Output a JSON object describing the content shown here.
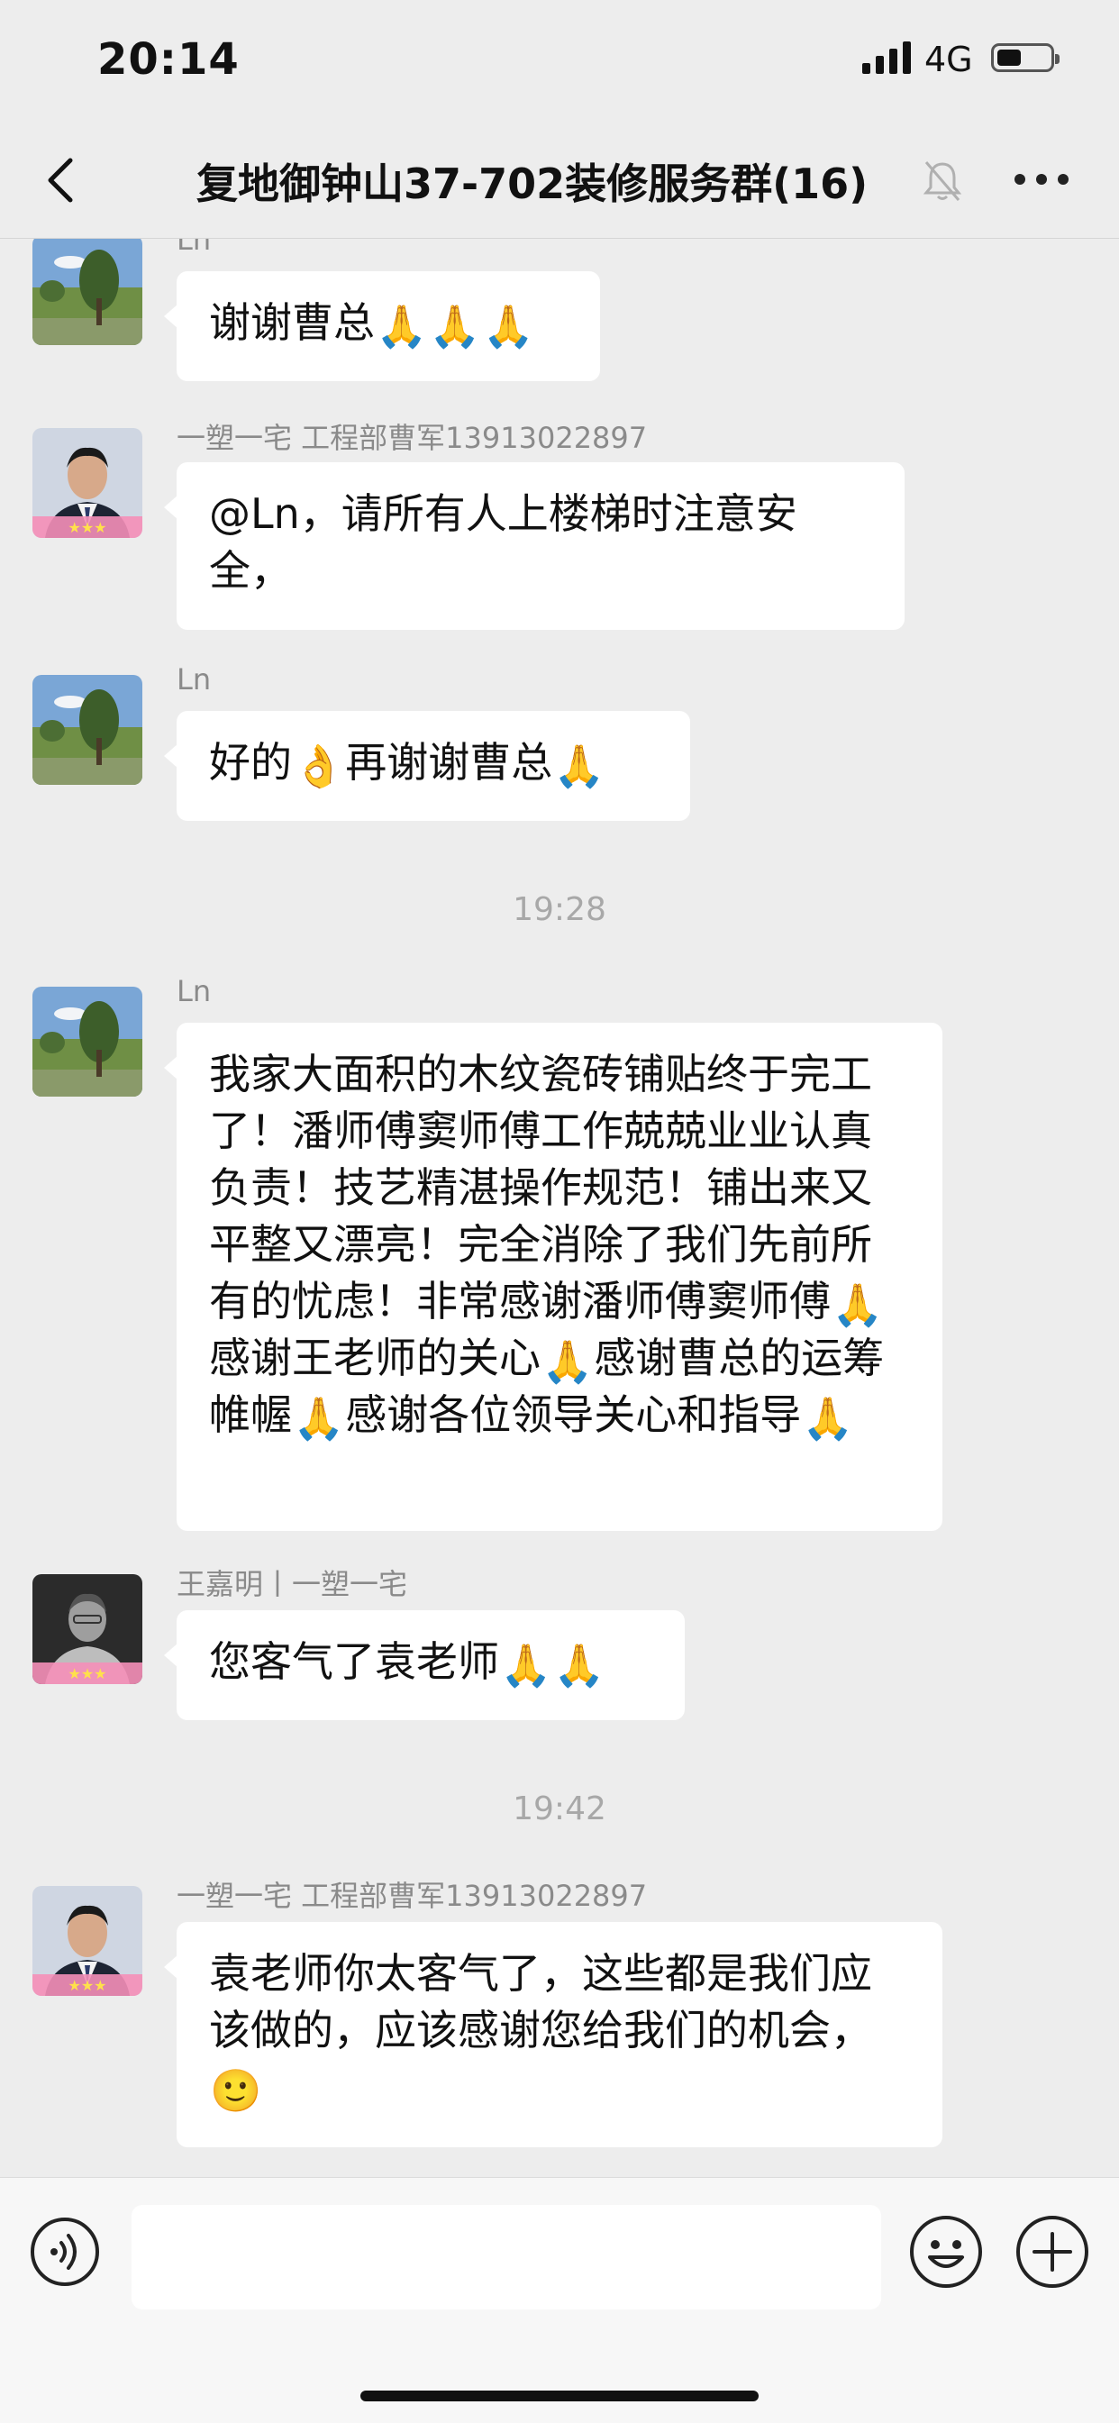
{
  "status": {
    "time": "20:14",
    "network": "4G"
  },
  "header": {
    "title": "复地御钟山37-702装修服务群(16)"
  },
  "icons": {
    "back": "chevron-left-icon",
    "mute": "bell-off-icon",
    "more": "more-dots-icon",
    "voice": "voice-input-icon",
    "emoji": "emoji-icon",
    "add": "plus-icon",
    "pray": "🙏",
    "ok": "👌",
    "smile": "🙂"
  },
  "messages": {
    "m1": {
      "sender": "Ln",
      "text": "谢谢曹总"
    },
    "m2": {
      "sender": "一塑一宅 工程部曹军13913022897",
      "text": "@Ln，请所有人上楼梯时注意安全，"
    },
    "m3": {
      "sender": "Ln",
      "text_a": "好的",
      "text_b": "再谢谢曹总"
    },
    "t1": "19:28",
    "m4": {
      "sender": "Ln",
      "text_a": "我家大面积的木纹瓷砖铺贴终于完工了！潘师傅窦师傅工作兢兢业业认真负责！技艺精湛操作规范！铺出来又平整又漂亮！完全消除了我们先前所有的忧虑！非常感谢潘师傅窦师傅",
      "text_b": "感谢王老师的关心",
      "text_c": "感谢曹总的运筹帷幄",
      "text_d": "感谢各位领导关心和指导"
    },
    "m5": {
      "sender": "王嘉明丨一塑一宅",
      "text": "您客气了袁老师"
    },
    "t2": "19:42",
    "m6": {
      "sender": "一塑一宅 工程部曹军13913022897",
      "text": "袁老师你太客气了，这些都是我们应该做的，应该感谢您给我们的机会，"
    }
  },
  "colors": {
    "background": "#ededed",
    "bubble": "#ffffff",
    "meta": "#8a8a8a",
    "timestamp": "#a8a8a8"
  }
}
